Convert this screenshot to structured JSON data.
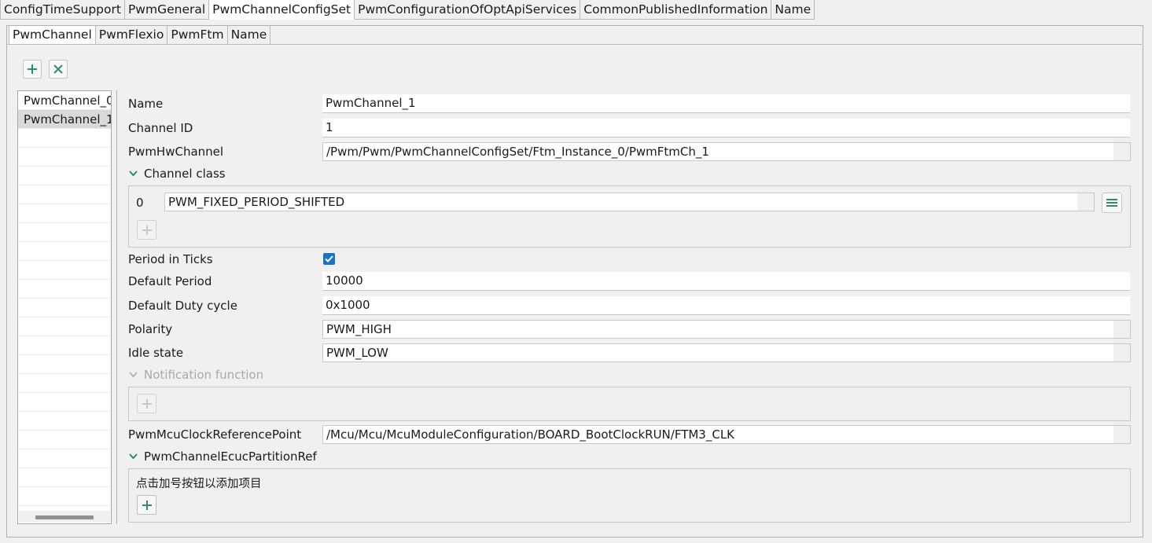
{
  "top_tabs": [
    {
      "label": "ConfigTimeSupport"
    },
    {
      "label": "PwmGeneral"
    },
    {
      "label": "PwmChannelConfigSet"
    },
    {
      "label": "PwmConfigurationOfOptApiServices"
    },
    {
      "label": "CommonPublishedInformation"
    },
    {
      "label": "Name"
    }
  ],
  "sub_tabs": [
    {
      "label": "PwmChannel"
    },
    {
      "label": "PwmFlexio"
    },
    {
      "label": "PwmFtm"
    },
    {
      "label": "Name"
    }
  ],
  "toolbar": {
    "add_icon": "plus-icon",
    "remove_icon": "x-icon",
    "accent": "#2e8b6e"
  },
  "channel_list": {
    "items": [
      "PwmChannel_0",
      "PwmChannel_1"
    ],
    "selected": "PwmChannel_1"
  },
  "form": {
    "name": {
      "label": "Name",
      "value": "PwmChannel_1"
    },
    "channel_id": {
      "label": "Channel ID",
      "value": "1"
    },
    "hw_channel": {
      "label": "PwmHwChannel",
      "value": "/Pwm/Pwm/PwmChannelConfigSet/Ftm_Instance_0/PwmFtmCh_1"
    },
    "channel_class": {
      "title": "Channel class",
      "index": "0",
      "value": "PWM_FIXED_PERIOD_SHIFTED"
    },
    "period_in_ticks": {
      "label": "Period in Ticks",
      "checked": true
    },
    "default_period": {
      "label": "Default Period",
      "value": "10000"
    },
    "default_duty": {
      "label": "Default Duty cycle",
      "value": "0x1000"
    },
    "polarity": {
      "label": "Polarity",
      "value": "PWM_HIGH"
    },
    "idle_state": {
      "label": "Idle state",
      "value": "PWM_LOW"
    },
    "notification": {
      "title": "Notification function"
    },
    "clock_ref": {
      "label": "PwmMcuClockReferencePoint",
      "value": "/Mcu/Mcu/McuModuleConfiguration/BOARD_BootClockRUN/FTM3_CLK"
    },
    "partition_ref": {
      "title": "PwmChannelEcucPartitionRef",
      "hint": "点击加号按钮以添加项目"
    }
  }
}
